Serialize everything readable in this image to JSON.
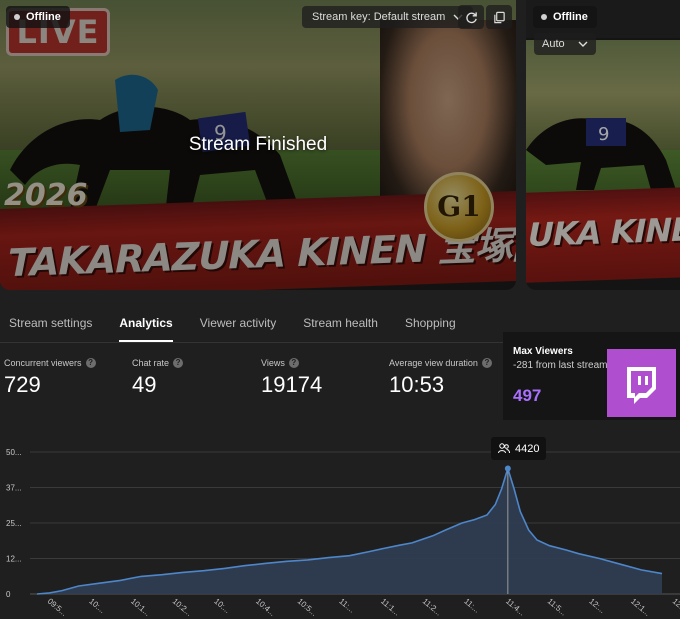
{
  "preview": {
    "status": "Offline",
    "stream_key_label": "Stream key: Default stream",
    "finished_text": "Stream Finished",
    "thumbnail": {
      "live_text": "LIVE",
      "year_text": "2026",
      "banner_text": "TAKARAZUKA KINEN 宝塚記念",
      "badge_text": "G1"
    }
  },
  "side_preview": {
    "status": "Offline",
    "quality_label": "Auto",
    "banner_text": "UKA KINEN 宝"
  },
  "tabs": [
    {
      "label": "Stream settings",
      "active": false
    },
    {
      "label": "Analytics",
      "active": true
    },
    {
      "label": "Viewer activity",
      "active": false
    },
    {
      "label": "Stream health",
      "active": false
    },
    {
      "label": "Shopping",
      "active": false
    }
  ],
  "metrics": [
    {
      "label": "Concurrent viewers",
      "value": "729"
    },
    {
      "label": "Chat rate",
      "value": "49"
    },
    {
      "label": "Views",
      "value": "19174"
    },
    {
      "label": "Average view duration",
      "value": "10:53"
    }
  ],
  "max_viewers": {
    "title": "Max Viewers",
    "subtitle": "-281 from last stream",
    "value": "497"
  },
  "colors": {
    "accent_purple": "#a970ff",
    "twitch_purple": "#b04ed0",
    "chart_line": "#4d86c9",
    "chart_fill": "#2f3d52"
  },
  "icons": {
    "offline_status": "dot-icon",
    "stream_key_dropdown": "chevron-down-icon",
    "refresh": "refresh-icon",
    "copy": "copy-icon",
    "auto_dropdown": "chevron-down-icon",
    "metric_help": "help-circle-icon",
    "peak_viewers": "people-icon",
    "brand_logo": "twitch-logo-icon"
  },
  "chart_data": {
    "type": "area",
    "y_tick_labels": [
      "0",
      "12...",
      "25...",
      "37...",
      "50..."
    ],
    "ylim": [
      0,
      5000
    ],
    "x_tick_labels": [
      "09:5...",
      "10:...",
      "10:1...",
      "10:2...",
      "10:...",
      "10:4...",
      "10:5...",
      "11:...",
      "11:1...",
      "11:2...",
      "11:...",
      "11:4...",
      "11:5...",
      "12:...",
      "12:1...",
      "12:2..."
    ],
    "peak": {
      "x_index": 11.3,
      "value": 4420,
      "label": "4420"
    },
    "series": [
      {
        "x": [
          0,
          0.3,
          0.6,
          1,
          1.5,
          2,
          2.5,
          3,
          3.5,
          4,
          4.5,
          5,
          5.5,
          6,
          6.5,
          7,
          7.5,
          8,
          8.3,
          8.7,
          9,
          9.5,
          9.8,
          10.2,
          10.5,
          10.8,
          11.0,
          11.15,
          11.3,
          11.45,
          11.6,
          11.8,
          12,
          12.3,
          12.7,
          13,
          13.5,
          14,
          14.5,
          15
        ],
        "y": [
          0,
          40,
          120,
          280,
          380,
          480,
          620,
          680,
          760,
          820,
          900,
          1000,
          1080,
          1150,
          1200,
          1280,
          1350,
          1500,
          1600,
          1720,
          1800,
          2050,
          2250,
          2500,
          2620,
          2780,
          3150,
          3700,
          4420,
          3700,
          2900,
          2250,
          1900,
          1700,
          1550,
          1420,
          1250,
          1050,
          850,
          720
        ]
      }
    ]
  }
}
